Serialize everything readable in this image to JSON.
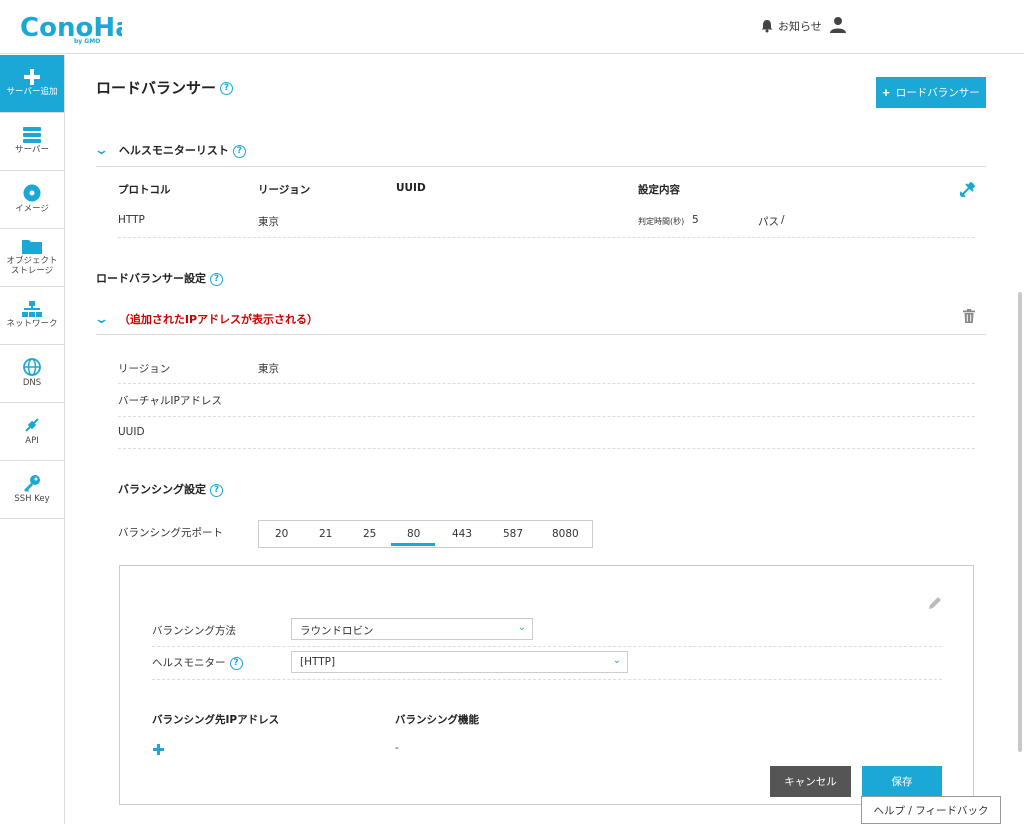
{
  "header": {
    "logo_text": "ConoHa",
    "logo_sub": "by GMO",
    "notifications_label": "お知らせ"
  },
  "sidebar": {
    "items": [
      {
        "label": "サーバー追加",
        "icon": "plus-icon"
      },
      {
        "label": "サーバー",
        "icon": "server-icon"
      },
      {
        "label": "イメージ",
        "icon": "disc-icon"
      },
      {
        "label": "オブジェクト\nストレージ",
        "icon": "folder-icon"
      },
      {
        "label": "ネットワーク",
        "icon": "network-icon"
      },
      {
        "label": "DNS",
        "icon": "globe-icon"
      },
      {
        "label": "API",
        "icon": "api-icon"
      },
      {
        "label": "SSH Key",
        "icon": "key-icon"
      }
    ]
  },
  "page": {
    "title": "ロードバランサー",
    "add_button": "ロードバランサー"
  },
  "health_monitor": {
    "title": "ヘルスモニターリスト",
    "columns": [
      "プロトコル",
      "リージョン",
      "UUID",
      "設定内容"
    ],
    "row": {
      "protocol": "HTTP",
      "region": "東京",
      "uuid": "",
      "interval_label": "判定時間(秒)",
      "interval_value": "5",
      "path_label": "パス",
      "path_value": "/"
    }
  },
  "lb_settings": {
    "title": "ロードバランサー設定",
    "lb_name": "（追加されたIPアドレスが表示される）",
    "rows": [
      {
        "label": "リージョン",
        "value": "東京"
      },
      {
        "label": "バーチャルIPアドレス",
        "value": ""
      },
      {
        "label": "UUID",
        "value": ""
      }
    ]
  },
  "balancing": {
    "title": "バランシング設定",
    "port_label": "バランシング元ポート",
    "ports": [
      "20",
      "21",
      "25",
      "80",
      "443",
      "587",
      "8080"
    ],
    "selected_port": "80",
    "method_label": "バランシング方法",
    "method_value": "ラウンドロビン",
    "health_label": "ヘルスモニター",
    "health_value": "[HTTP]",
    "dest_ip_label": "バランシング先IPアドレス",
    "function_label": "バランシング機能",
    "function_value": "-",
    "cancel": "キャンセル",
    "save": "保存"
  },
  "feedback": "ヘルプ / フィードバック",
  "colors": {
    "accent": "#1ba8d6",
    "cancel": "#555555",
    "danger_text": "#cc0000"
  }
}
